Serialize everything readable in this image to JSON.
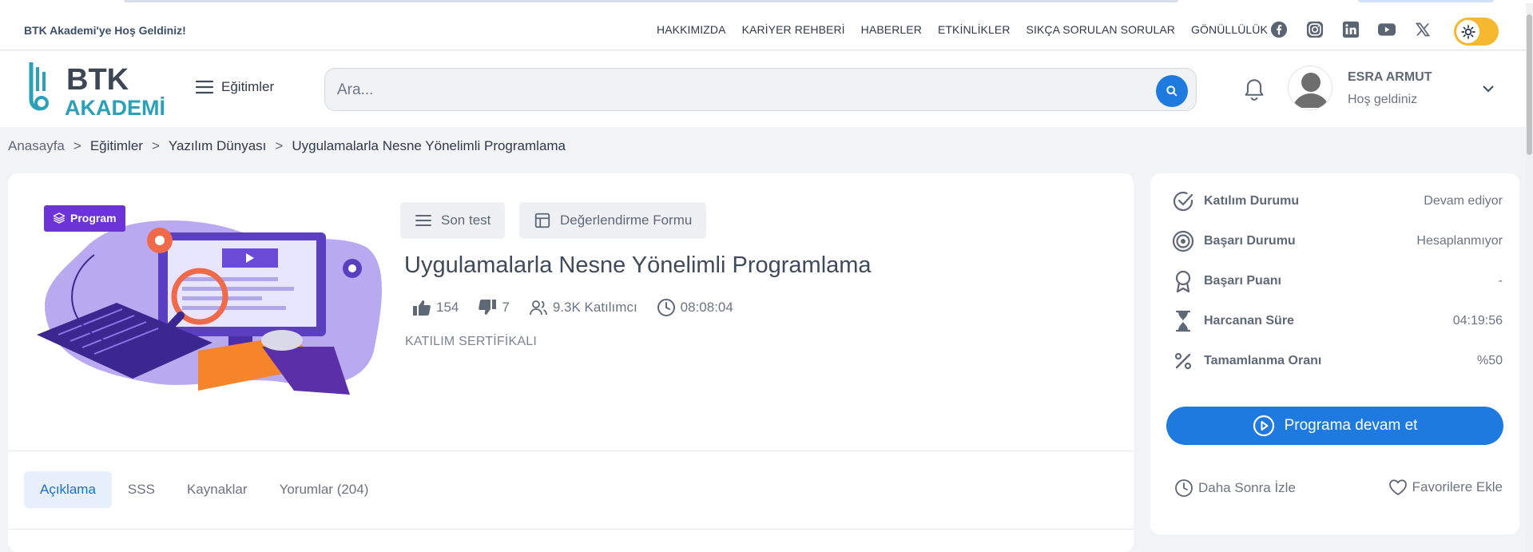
{
  "topbar": {
    "welcome": "BTK Akademi'ye Hoş Geldiniz!",
    "links": [
      "HAKKIMIZDA",
      "KARİYER REHBERİ",
      "HABERLER",
      "ETKİNLİKLER",
      "SIKÇA SORULAN SORULAR",
      "GÖNÜLLÜLÜK"
    ],
    "socials": [
      "facebook-icon",
      "instagram-icon",
      "linkedin-icon",
      "youtube-icon",
      "x-icon"
    ],
    "theme_toggle": "sun-icon"
  },
  "header": {
    "logo_text_top": "BTK",
    "logo_text_bottom": "AKADEMİ",
    "menu_label": "Eğitimler",
    "search_placeholder": "Ara...",
    "user_name": "ESRA ARMUT",
    "user_greeting": "Hoş geldiniz"
  },
  "breadcrumb": [
    "Anasayfa",
    "Eğitimler",
    "Yazılım Dünyası",
    "Uygulamalarla Nesne Yönelimli Programlama"
  ],
  "course": {
    "badge": "Program",
    "actions": [
      "Son test",
      "Değerlendirme Formu"
    ],
    "title": "Uygulamalarla Nesne Yönelimli Programlama",
    "likes": "154",
    "dislikes": "7",
    "participants": "9.3K Katılımcı",
    "duration": "08:08:04",
    "certificate": "KATILIM SERTİFİKALI",
    "tabs": [
      "Açıklama",
      "SSS",
      "Kaynaklar",
      "Yorumlar (204)"
    ],
    "active_tab": "Açıklama"
  },
  "sidebar": {
    "rows": [
      {
        "label": "Katılım Durumu",
        "value": "Devam ediyor",
        "icon": "check-circle-icon"
      },
      {
        "label": "Başarı Durumu",
        "value": "Hesaplanmıyor",
        "icon": "target-icon"
      },
      {
        "label": "Başarı Puanı",
        "value": "-",
        "icon": "award-icon"
      },
      {
        "label": "Harcanan Süre",
        "value": "04:19:56",
        "icon": "hourglass-icon"
      },
      {
        "label": "Tamamlanma Oranı",
        "value": "%50",
        "icon": "percent-icon"
      }
    ],
    "cta": "Programa devam et",
    "watch_later": "Daha Sonra İzle",
    "favorite": "Favorilere Ekle"
  },
  "colors": {
    "primary": "#1f7ae0",
    "badge": "#6c33d6",
    "toggle": "#f5b82e",
    "logo": "#2aa1b8"
  }
}
